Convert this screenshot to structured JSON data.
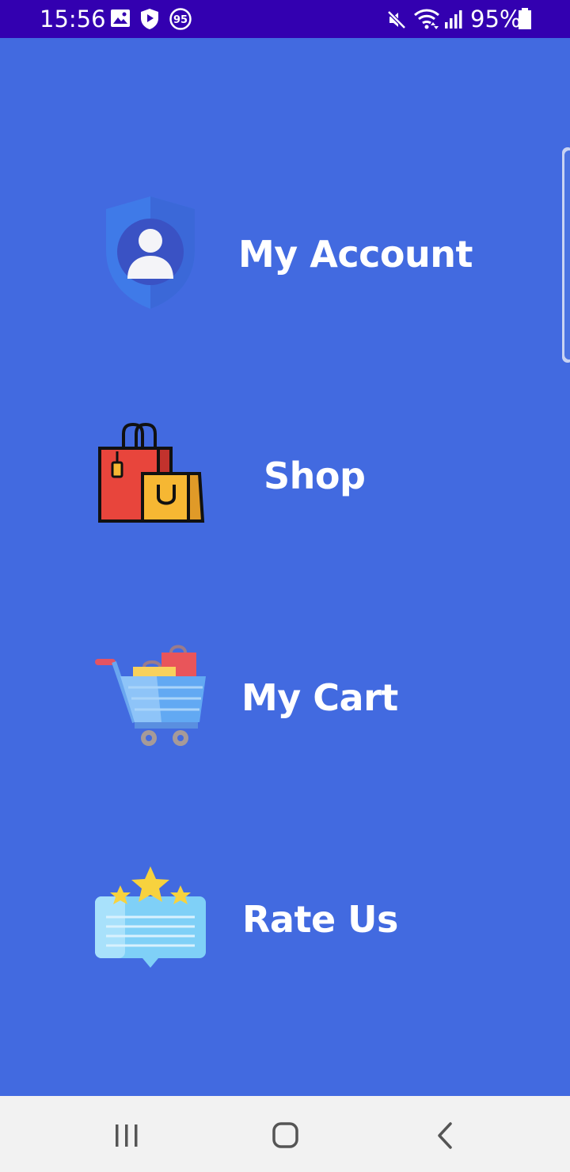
{
  "status_bar": {
    "time": "15:56",
    "notification_badge": "95",
    "battery": "95%",
    "icons": [
      "gallery-icon",
      "shield-icon",
      "badge-95-icon",
      "mute-icon",
      "wifi-icon",
      "signal-icon",
      "battery-icon"
    ],
    "background": "#3300b0"
  },
  "theme": {
    "background": "#426ae0",
    "text_color": "#ffffff",
    "nav_background": "#f2f2f2"
  },
  "menu": {
    "items": [
      {
        "label": "My Account",
        "icon": "account-shield-icon"
      },
      {
        "label": "Shop",
        "icon": "shopping-bags-icon"
      },
      {
        "label": "My Cart",
        "icon": "shopping-cart-icon"
      },
      {
        "label": "Rate Us",
        "icon": "rating-stars-icon"
      }
    ]
  },
  "nav_bar": {
    "buttons": [
      "recent-apps-icon",
      "home-icon",
      "back-icon"
    ]
  }
}
